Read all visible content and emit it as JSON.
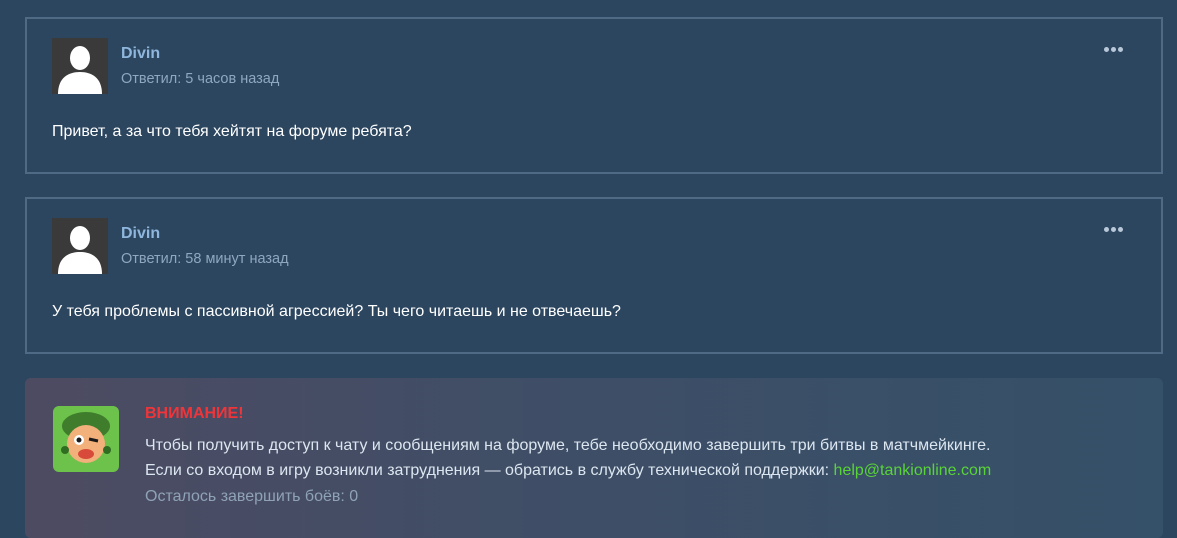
{
  "posts": [
    {
      "author": "Divin",
      "meta": "Ответил: 5 часов назад",
      "text": "Привет, а за что тебя хейтят на форуме ребята?"
    },
    {
      "author": "Divin",
      "meta": "Ответил: 58 минут назад",
      "text": "У тебя проблемы с пассивной агрессией? Ты чего читаешь и не отвечаешь?"
    }
  ],
  "notice": {
    "title": "ВНИМАНИЕ!",
    "line1": "Чтобы получить доступ к чату и сообщениям на форуме, тебе необходимо завершить три битвы в матчмейкинге.",
    "line2": "Если со входом в игру возникли затруднения — обратись в службу технической поддержки: ",
    "email": "help@tankionline.com",
    "remaining": "Осталось завершить боёв: 0"
  },
  "colors": {
    "background": "#2c4660",
    "author": "#8fb6dc",
    "warning": "#f0353a",
    "link": "#58d437"
  },
  "icons": {
    "avatar": "default-avatar-silhouette",
    "menu": "more-horizontal-icon",
    "notice": "mascot-icon"
  }
}
